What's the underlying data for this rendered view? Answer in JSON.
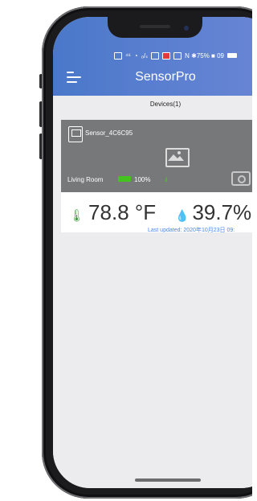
{
  "status_bar": {
    "text_right": "N ✱75% ■ 09"
  },
  "header": {
    "title": "SensorPro"
  },
  "devices": {
    "title": "Devices(1)"
  },
  "device": {
    "name": "Sensor_4C6C95",
    "location": "Living Room",
    "battery": "100%",
    "temperature": "78.8 °F",
    "humidity": "39.7%",
    "last_updated": "Last updated: 2020年10月23日 09:"
  },
  "colors": {
    "header": "#5b7fd0",
    "card_top": "#77787a",
    "battery": "#44c21d",
    "link": "#4a86e8",
    "icon_green": "#3d9f3f"
  }
}
